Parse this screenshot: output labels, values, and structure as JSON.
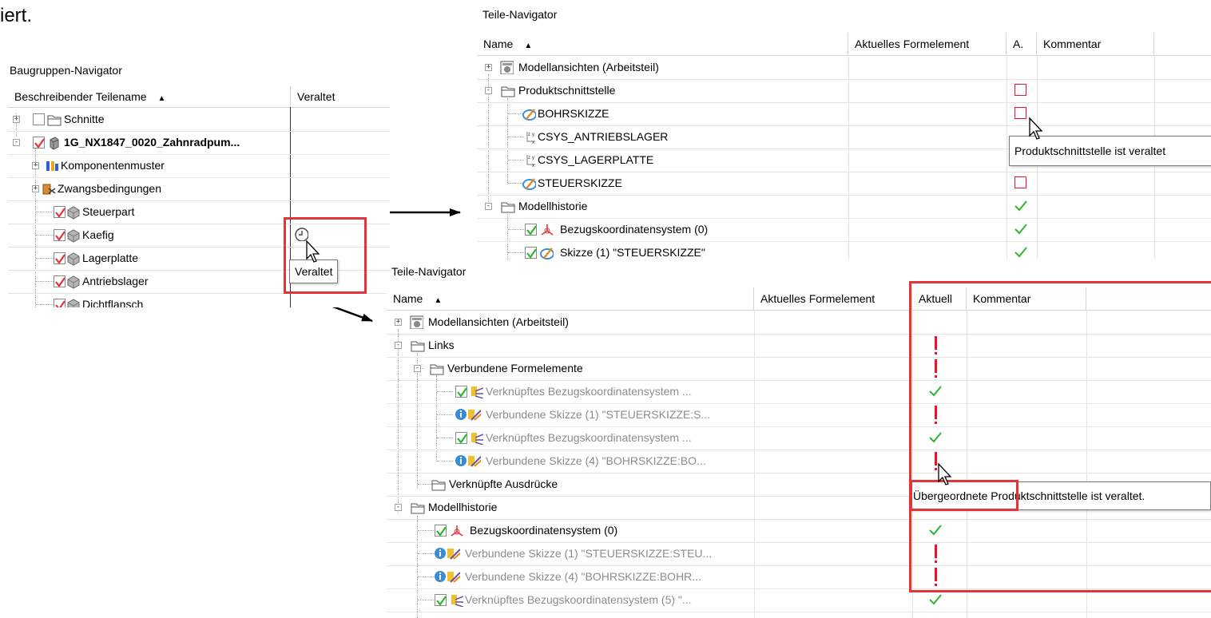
{
  "intro_fragment": "iert.",
  "left": {
    "title": "Baugruppen-Navigator",
    "col_name": "Beschreibender Teilename",
    "col_status": "Veraltet",
    "rows": [
      {
        "label": "Schnitte"
      },
      {
        "label": "1G_NX1847_0020_Zahnradpum..."
      },
      {
        "label": "Komponentenmuster"
      },
      {
        "label": "Zwangsbedingungen"
      },
      {
        "label": "Steuerpart"
      },
      {
        "label": "Kaefig"
      },
      {
        "label": "Lagerplatte"
      },
      {
        "label": "Antriebslager"
      },
      {
        "label": "Dichtflansch"
      }
    ],
    "tooltip": "Veraltet"
  },
  "top": {
    "title": "Teile-Navigator",
    "col_name": "Name",
    "col_feature": "Aktuelles Formelement",
    "col_a": "A.",
    "col_comment": "Kommentar",
    "rows": [
      {
        "label": "Modellansichten (Arbeitsteil)"
      },
      {
        "label": "Produktschnittstelle"
      },
      {
        "label": "BOHRSKIZZE"
      },
      {
        "label": "CSYS_ANTRIEBSLAGER"
      },
      {
        "label": "CSYS_LAGERPLATTE"
      },
      {
        "label": "STEUERSKIZZE"
      },
      {
        "label": "Modellhistorie"
      },
      {
        "label": "Bezugskoordinatensystem (0)"
      },
      {
        "label": "Skizze (1) \"STEUERSKIZZE\""
      }
    ],
    "tooltip": "Produktschnittstelle ist veraltet"
  },
  "bottom": {
    "title": "Teile-Navigator",
    "col_name": "Name",
    "col_feature": "Aktuelles Formelement",
    "col_current": "Aktuell",
    "col_comment": "Kommentar",
    "rows": [
      {
        "label": "Modellansichten (Arbeitsteil)"
      },
      {
        "label": "Links"
      },
      {
        "label": "Verbundene Formelemente"
      },
      {
        "label": "Verknüpftes Bezugskoordinatensystem ..."
      },
      {
        "label": "Verbundene Skizze (1) \"STEUERSKIZZE:S..."
      },
      {
        "label": "Verknüpftes Bezugskoordinatensystem ..."
      },
      {
        "label": "Verbundene Skizze (4) \"BOHRSKIZZE:BO..."
      },
      {
        "label": "Verknüpfte Ausdrücke"
      },
      {
        "label": "Modellhistorie"
      },
      {
        "label": "Bezugskoordinatensystem (0)"
      },
      {
        "label": "Verbundene Skizze (1) \"STEUERSKIZZE:STEU..."
      },
      {
        "label": "Verbundene Skizze (4) \"BOHRSKIZZE:BOHR..."
      },
      {
        "label": "Verknüpftes Bezugskoordinatensystem (5) \"..."
      }
    ],
    "tooltip_part1": "Übergeordnete",
    "tooltip_part2": " Produktschnittstelle ist veraltet."
  },
  "colors": {
    "highlight": "#e3343a",
    "check": "#2fb62f",
    "warn": "#e8142a"
  },
  "icons": [
    "folder-icon",
    "checkbox-icon",
    "part-icon",
    "component-pattern-icon",
    "constraints-icon",
    "views-icon",
    "sketch-icon",
    "csys-icon",
    "datum-csys-icon",
    "linked-csys-icon",
    "linked-sketch-icon",
    "info-icon",
    "clock-icon",
    "mouse-cursor-icon",
    "checkmark-icon",
    "exclamation-icon",
    "arrow-icon"
  ]
}
